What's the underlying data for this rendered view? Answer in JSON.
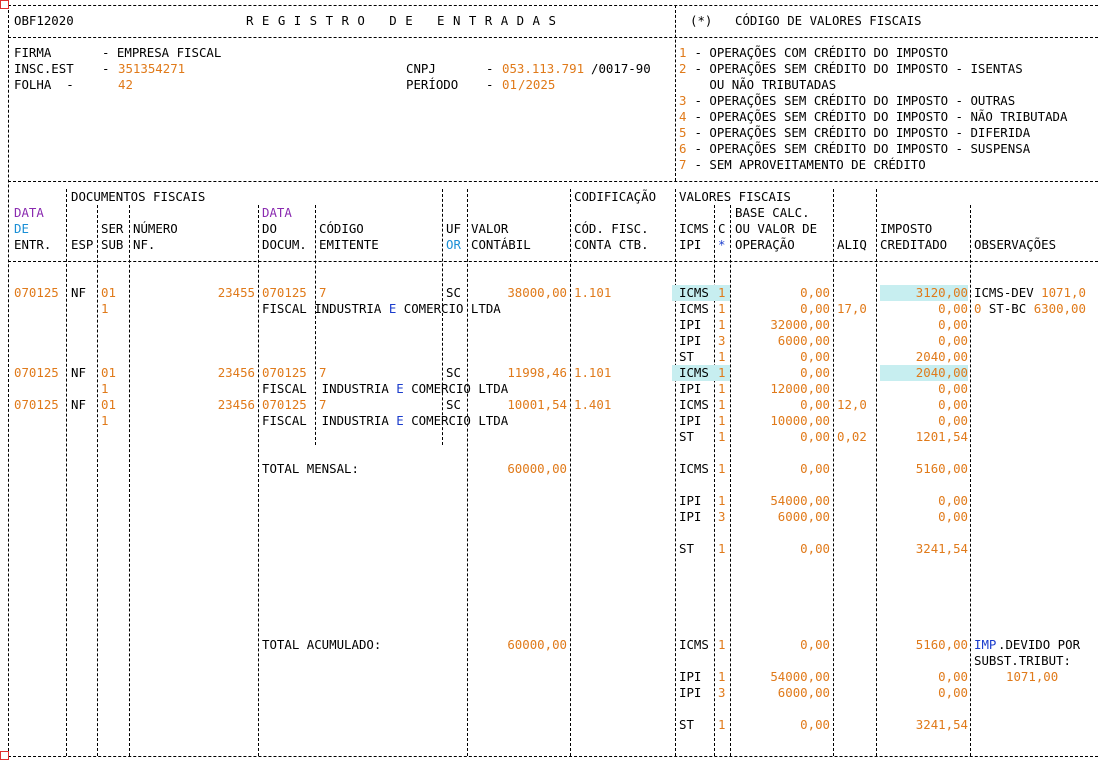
{
  "header": {
    "program": "OBF12020",
    "title": "R E G I S T R O   D E   E N T R A D A S",
    "legend_mark": "(*)",
    "legend_title": "CÓDIGO DE VALORES FISCAIS"
  },
  "company": {
    "firma_label": "FIRMA",
    "firma_value": "- EMPRESA FISCAL",
    "insc_label": "INSC.EST",
    "insc_value": "351354271",
    "folha_label": "FOLHA  -",
    "folha_value": "42",
    "cnpj_label": "CNPJ",
    "cnpj_value": "053.113.791",
    "cnpj_suffix": "/0017-90",
    "periodo_label": "PERÍODO",
    "periodo_month": "01",
    "periodo_year": "/2025"
  },
  "codes": [
    {
      "n": "1",
      "text": " - OPERAÇÕES COM CRÉDITO DO IMPOSTO"
    },
    {
      "n": "2",
      "text": " - OPERAÇÕES SEM CRÉDITO DO IMPOSTO - ISENTAS"
    },
    {
      "n": "",
      "text": "   OU NÃO TRIBUTADAS"
    },
    {
      "n": "3",
      "text": " - OPERAÇÕES SEM CRÉDITO DO IMPOSTO - OUTRAS"
    },
    {
      "n": "4",
      "text": " - OPERAÇÕES SEM CRÉDITO DO IMPOSTO - NÃO TRIBUTADA"
    },
    {
      "n": "5",
      "text": " - OPERAÇÕES SEM CRÉDITO DO IMPOSTO - DIFERIDA"
    },
    {
      "n": "6",
      "text": " - OPERAÇÕES SEM CRÉDITO DO IMPOSTO - SUSPENSA"
    },
    {
      "n": "7",
      "text": " - SEM APROVEITAMENTO DE CRÉDITO"
    }
  ],
  "columns": {
    "docs_fiscais": "DOCUMENTOS FISCAIS",
    "codificacao": "CODIFICAÇÃO",
    "valores_fiscais": "VALORES FISCAIS",
    "data": "DATA",
    "de": "DE",
    "entr": "ENTR.",
    "esp": "ESP",
    "ser": "SER",
    "sub": "SUB",
    "numero": "NÚMERO",
    "nf": "NF.",
    "data2": "DATA",
    "do": "DO",
    "docum": "DOCUM.",
    "codigo": "CÓDIGO",
    "emitente": "EMITENTE",
    "uf": "UF",
    "or": "OR",
    "valor": "VALOR",
    "contabil": "CONTÁBIL",
    "cod_fisc": "CÓD. FISC.",
    "conta_ctb": "CONTA CTB.",
    "icms": "ICMS",
    "ipi": "IPI",
    "c": "C",
    "star": "*",
    "base_calc": "BASE CALC.",
    "ou_valor": "OU VALOR DE",
    "operacao": "OPERAÇÃO",
    "aliq": "ALIQ",
    "imposto": "IMPOSTO",
    "creditado": "CREDITADO",
    "observacoes": "OBSERVAÇÕES"
  },
  "documents": [
    {
      "data": "070125",
      "esp": "NF",
      "ser": "01",
      "sub": "1",
      "numero": "23455",
      "data_doc": "070125",
      "codigo": "7",
      "emitente": "FISCAL INDUSTRIA E COMERCIO LTDA",
      "uf": "SC",
      "valor": "38000,00",
      "cod_fisc": "1.101"
    },
    {
      "data": "070125",
      "esp": "NF",
      "ser": "01",
      "sub": "1",
      "numero": "23456",
      "data_doc": "070125",
      "codigo": "7",
      "emitente": "FISCAL  INDUSTRIA E COMERCIO LTDA",
      "uf": "SC",
      "valor": "11998,46",
      "cod_fisc": "1.101"
    },
    {
      "data": "070125",
      "esp": "NF",
      "ser": "01",
      "sub": "1",
      "numero": "23456",
      "data_doc": "070125",
      "codigo": "7",
      "emitente": "FISCAL  INDUSTRIA E COMERCIO LTDA",
      "uf": "SC",
      "valor": "10001,54",
      "cod_fisc": "1.401"
    }
  ],
  "fiscal_rows": [
    {
      "tax": "ICMS",
      "c": "1",
      "base": "0,00",
      "aliq": "",
      "imposto": "3120,00",
      "obs": "ICMS-DEV 1071,0",
      "hl": true
    },
    {
      "tax": "ICMS",
      "c": "1",
      "base": "0,00",
      "aliq": "17,0",
      "imposto": "0,00",
      "obs": "0 ST-BC 6300,00",
      "hl": false
    },
    {
      "tax": "IPI",
      "c": "1",
      "base": "32000,00",
      "aliq": "",
      "imposto": "0,00",
      "obs": "",
      "hl": false
    },
    {
      "tax": "IPI",
      "c": "3",
      "base": "6000,00",
      "aliq": "",
      "imposto": "0,00",
      "obs": "",
      "hl": false
    },
    {
      "tax": "ST",
      "c": "1",
      "base": "0,00",
      "aliq": "",
      "imposto": "2040,00",
      "obs": "",
      "hl": false
    },
    {
      "tax": "ICMS",
      "c": "1",
      "base": "0,00",
      "aliq": "",
      "imposto": "2040,00",
      "obs": "",
      "hl": true
    },
    {
      "tax": "IPI",
      "c": "1",
      "base": "12000,00",
      "aliq": "",
      "imposto": "0,00",
      "obs": "",
      "hl": false
    },
    {
      "tax": "ICMS",
      "c": "1",
      "base": "0,00",
      "aliq": "12,0",
      "imposto": "0,00",
      "obs": "",
      "hl": false
    },
    {
      "tax": "IPI",
      "c": "1",
      "base": "10000,00",
      "aliq": "",
      "imposto": "0,00",
      "obs": "",
      "hl": false
    },
    {
      "tax": "ST",
      "c": "1",
      "base": "0,00",
      "aliq": "0,02",
      "imposto": "1201,54",
      "obs": "",
      "hl": false
    }
  ],
  "total_mensal": {
    "label": "TOTAL MENSAL:",
    "valor": "60000,00",
    "rows": [
      {
        "tax": "ICMS",
        "c": "1",
        "base": "0,00",
        "imposto": "5160,00"
      },
      {
        "tax": "IPI",
        "c": "1",
        "base": "54000,00",
        "imposto": "0,00"
      },
      {
        "tax": "IPI",
        "c": "3",
        "base": "6000,00",
        "imposto": "0,00"
      },
      {
        "tax": "ST",
        "c": "1",
        "base": "0,00",
        "imposto": "3241,54"
      }
    ]
  },
  "total_acumulado": {
    "label": "TOTAL ACUMULADO:",
    "valor": "60000,00",
    "rows": [
      {
        "tax": "ICMS",
        "c": "1",
        "base": "0,00",
        "imposto": "5160,00"
      },
      {
        "tax": "IPI",
        "c": "1",
        "base": "54000,00",
        "imposto": "0,00"
      },
      {
        "tax": "IPI",
        "c": "3",
        "base": "6000,00",
        "imposto": "0,00"
      },
      {
        "tax": "ST",
        "c": "1",
        "base": "0,00",
        "imposto": "3241,54"
      }
    ],
    "obs_line1_a": "IMP",
    "obs_line1_b": ".DEVIDO POR",
    "obs_line2": "SUBST.TRIBUT:",
    "obs_line3": "1071,00"
  }
}
